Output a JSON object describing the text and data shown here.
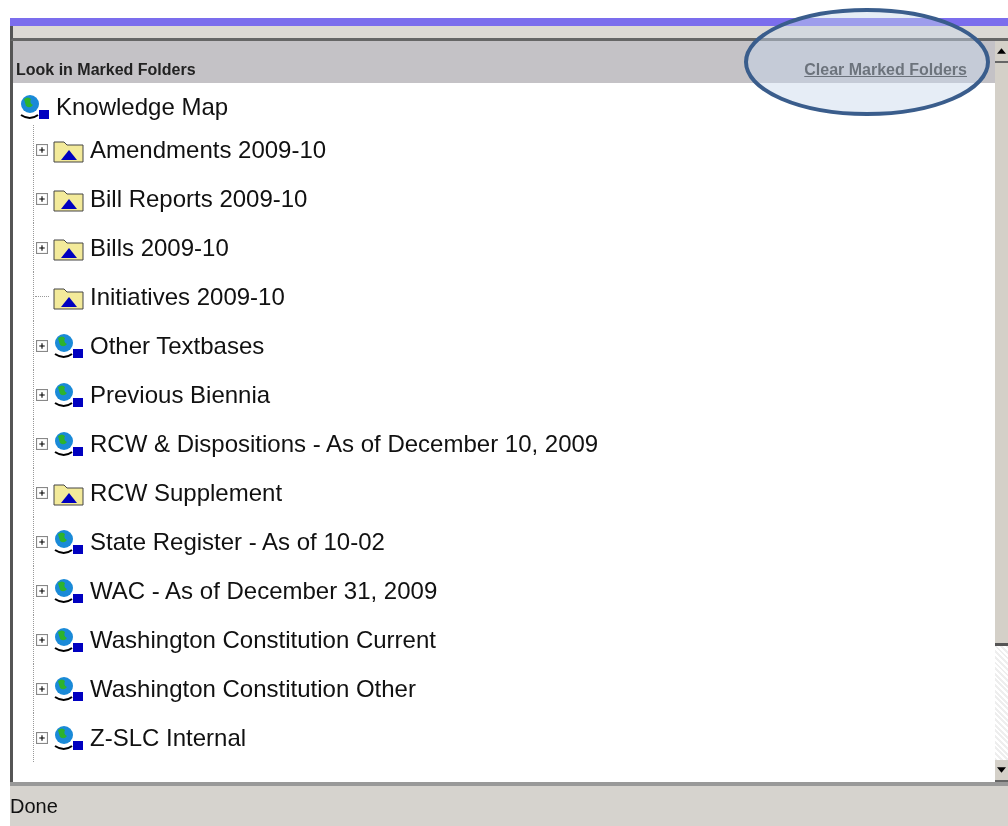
{
  "header": {
    "title": "Look in Marked Folders",
    "clear_link": "Clear Marked Folders"
  },
  "tree": {
    "root": {
      "label": "Knowledge Map",
      "kind": "globe"
    },
    "children": [
      {
        "label": "Amendments 2009-10",
        "kind": "folder",
        "expander": true
      },
      {
        "label": "Bill Reports 2009-10",
        "kind": "folder",
        "expander": true
      },
      {
        "label": "Bills 2009-10",
        "kind": "folder",
        "expander": true
      },
      {
        "label": "Initiatives 2009-10",
        "kind": "folder",
        "expander": false
      },
      {
        "label": "Other Textbases",
        "kind": "globe",
        "expander": true
      },
      {
        "label": "Previous Biennia",
        "kind": "globe",
        "expander": true
      },
      {
        "label": "RCW & Dispositions - As of December 10, 2009",
        "kind": "globe",
        "expander": true
      },
      {
        "label": "RCW Supplement",
        "kind": "folder",
        "expander": true
      },
      {
        "label": "State Register - As of 10-02",
        "kind": "globe",
        "expander": true
      },
      {
        "label": "WAC - As of December 31, 2009",
        "kind": "globe",
        "expander": true
      },
      {
        "label": "Washington Constitution Current",
        "kind": "globe",
        "expander": true
      },
      {
        "label": "Washington Constitution Other",
        "kind": "globe",
        "expander": true
      },
      {
        "label": "Z-SLC Internal",
        "kind": "globe",
        "expander": true
      }
    ]
  },
  "status_bar": {
    "text": "Done"
  }
}
